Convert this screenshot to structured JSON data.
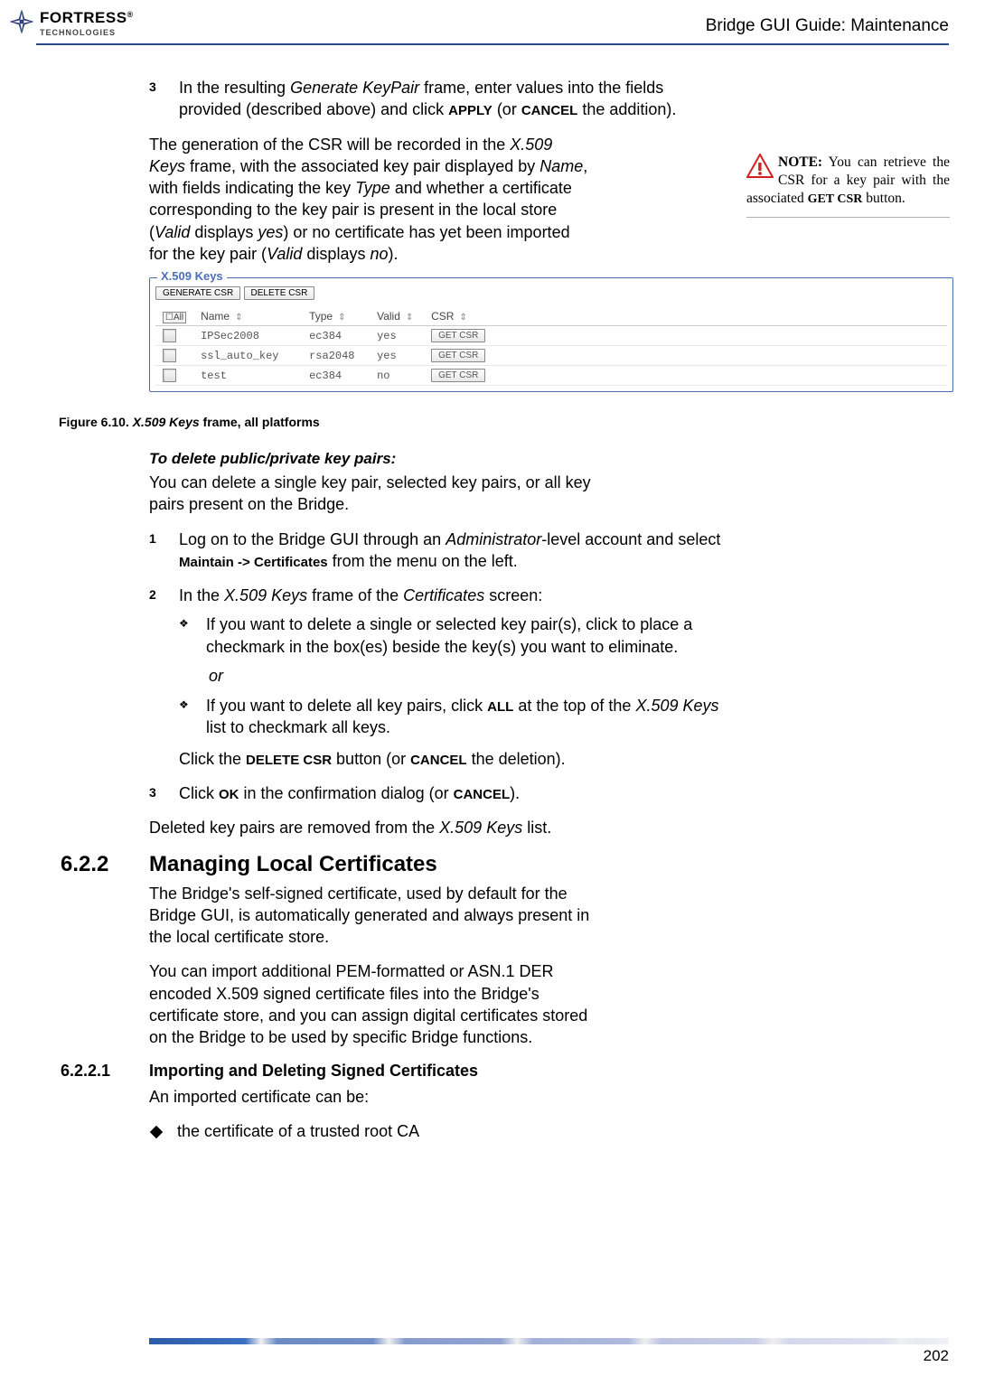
{
  "header": {
    "logo_line1": "FORTRESS",
    "logo_reg": "®",
    "logo_line2": "TECHNOLOGIES",
    "title": "Bridge GUI Guide: Maintenance"
  },
  "step3": {
    "num": "3",
    "t1": "In the resulting ",
    "i1": "Generate KeyPair",
    "t2": " frame, enter values into the fields provided (described above) and click ",
    "sc1": "APPLY",
    "t3": " (or ",
    "sc2": "CANCEL",
    "t4": " the addition)."
  },
  "para1": {
    "t1": "The generation of the CSR will be recorded in the ",
    "i1": "X.509 Keys",
    "t2": " frame, with the associated key pair displayed by ",
    "i2": "Name",
    "t3": ", with fields indicating the key ",
    "i3": "Type",
    "t4": " and whether a certificate corresponding to the key pair is present in the local store (",
    "i4": "Valid",
    "t5": " displays ",
    "i5": "yes",
    "t6": ") or no certificate has yet been imported for the key pair (",
    "i6": "Valid",
    "t7": " displays ",
    "i7": "no",
    "t8": ")."
  },
  "sidenote": {
    "label": "NOTE:",
    "t1": " You can re­trieve the CSR for a key pair with the asso­ciated ",
    "sc1": "GET CSR",
    "t2": " button."
  },
  "fieldset": {
    "legend": "X.509 Keys",
    "btn_gen": "GENERATE CSR",
    "btn_del": "DELETE CSR",
    "hdr_all": "All",
    "hdr_name": "Name",
    "hdr_type": "Type",
    "hdr_valid": "Valid",
    "hdr_csr": "CSR",
    "btn_get": "GET CSR"
  },
  "chart_data": {
    "type": "table",
    "columns": [
      "Name",
      "Type",
      "Valid",
      "CSR"
    ],
    "rows": [
      {
        "name": "IPSec2008",
        "type": "ec384",
        "valid": "yes",
        "csr": "GET CSR"
      },
      {
        "name": "ssl_auto_key",
        "type": "rsa2048",
        "valid": "yes",
        "csr": "GET CSR"
      },
      {
        "name": "test",
        "type": "ec384",
        "valid": "no",
        "csr": "GET CSR"
      }
    ]
  },
  "figcap": {
    "label": "Figure 6.10.  ",
    "title": "X.509 Keys",
    "rest": " frame, all platforms"
  },
  "delhead": "To delete public/private key pairs:",
  "delpara": "You can delete a single key pair, selected key pairs, or all key pairs present on the Bridge.",
  "dstep1": {
    "num": "1",
    "t1": "Log on to the Bridge GUI through an ",
    "i1": "Administrator",
    "t2": "-level account and select ",
    "u1": "Maintain",
    "u2": " -> ",
    "u3": "Certificates",
    "t3": " from the menu on the left."
  },
  "dstep2": {
    "num": "2",
    "t1": "In the ",
    "i1": "X.509 Keys",
    "t2": " frame of the ",
    "i2": "Certificates",
    "t3": " screen:"
  },
  "bullet1": "If you want to delete a single or selected key pair(s), click to place a checkmark in the box(es) beside the key(s) you want to eliminate.",
  "or": "or",
  "bullet2": {
    "t1": "If you want to delete all key pairs, click ",
    "sc1": "ALL",
    "t2": " at the top of the ",
    "i1": "X.509 Keys",
    "t3": " list to checkmark all keys."
  },
  "clickdel": {
    "t1": "Click the ",
    "sc1": "DELETE CSR",
    "t2": " button (or ",
    "sc2": "CANCEL",
    "t3": " the deletion)."
  },
  "dstep3": {
    "num": "3",
    "t1": "Click ",
    "sc1": "OK",
    "t2": " in the confirmation dialog (or ",
    "sc2": "CANCEL",
    "t3": ")."
  },
  "delfinal": {
    "t1": "Deleted key pairs are removed from the ",
    "i1": "X.509 Keys",
    "t2": " list."
  },
  "sec622": {
    "num": "6.2.2",
    "title": "Managing Local Certificates",
    "p1": "The Bridge's self-signed certificate, used by default for the Bridge GUI, is automatically generated and always present in the local certificate store.",
    "p2": "You can import additional PEM-formatted or ASN.1 DER encoded X.509 signed certificate files into the Bridge's certificate store, and you can assign digital certificates stored on the Bridge to be used by specific Bridge functions."
  },
  "sec6221": {
    "num": "6.2.2.1",
    "title": "Importing and Deleting Signed Certificates",
    "p1": "An imported certificate can be:",
    "b1": "the certificate of a trusted root CA"
  },
  "pagenum": "202"
}
